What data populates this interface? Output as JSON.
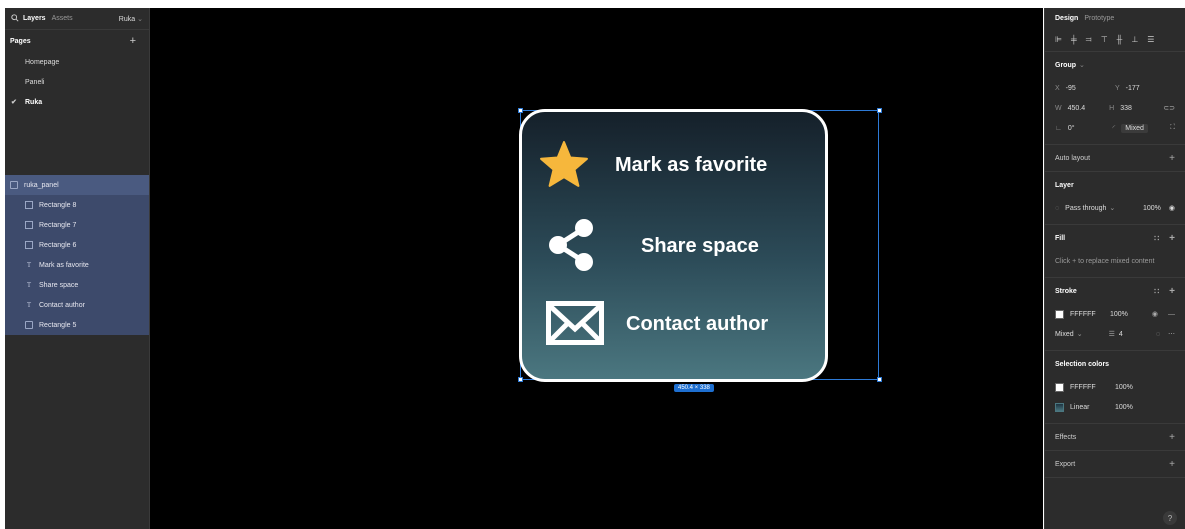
{
  "left": {
    "search_icon": "search-icon",
    "tab_layers": "Layers",
    "tab_assets": "Assets",
    "project": "Ruka",
    "pages_header": "Pages",
    "add_page": "+",
    "pages": [
      {
        "label": "Homepage",
        "selected": false
      },
      {
        "label": "Paneli",
        "selected": false
      },
      {
        "label": "Ruka",
        "selected": true
      }
    ],
    "layers": [
      {
        "label": "ruka_panel",
        "kind": "frame"
      },
      {
        "label": "Rectangle 8",
        "kind": "image"
      },
      {
        "label": "Rectangle 7",
        "kind": "image"
      },
      {
        "label": "Rectangle 6",
        "kind": "image"
      },
      {
        "label": "Mark as favorite",
        "kind": "text"
      },
      {
        "label": "Share space",
        "kind": "text"
      },
      {
        "label": "Contact author",
        "kind": "text"
      },
      {
        "label": "Rectangle 5",
        "kind": "rect"
      }
    ]
  },
  "canvas": {
    "rows": [
      {
        "label": "Mark as favorite",
        "icon": "star-icon"
      },
      {
        "label": "Share space",
        "icon": "share-icon"
      },
      {
        "label": "Contact author",
        "icon": "mail-icon"
      }
    ],
    "dimension_badge": "450.4 × 338",
    "star_color": "#f6b73c"
  },
  "right": {
    "tab_design": "Design",
    "tab_prototype": "Prototype",
    "group_label": "Group",
    "x_label": "X",
    "x_value": "-95",
    "y_label": "Y",
    "y_value": "-177",
    "w_label": "W",
    "w_value": "450.4",
    "h_label": "H",
    "h_value": "338",
    "rotation": "0°",
    "radius": "Mixed",
    "auto_layout": "Auto layout",
    "layer_header": "Layer",
    "blend": "Pass through",
    "layer_opacity": "100%",
    "fill_header": "Fill",
    "fill_hint": "Click + to replace mixed content",
    "stroke_header": "Stroke",
    "stroke_color": "FFFFFF",
    "stroke_opacity": "100%",
    "stroke_position": "Mixed",
    "stroke_weight": "4",
    "selection_colors_header": "Selection colors",
    "sel_colors": [
      {
        "label": "FFFFFF",
        "opacity": "100%",
        "kind": "solid"
      },
      {
        "label": "Linear",
        "opacity": "100%",
        "kind": "linear"
      }
    ],
    "effects": "Effects",
    "export": "Export",
    "help": "?"
  }
}
